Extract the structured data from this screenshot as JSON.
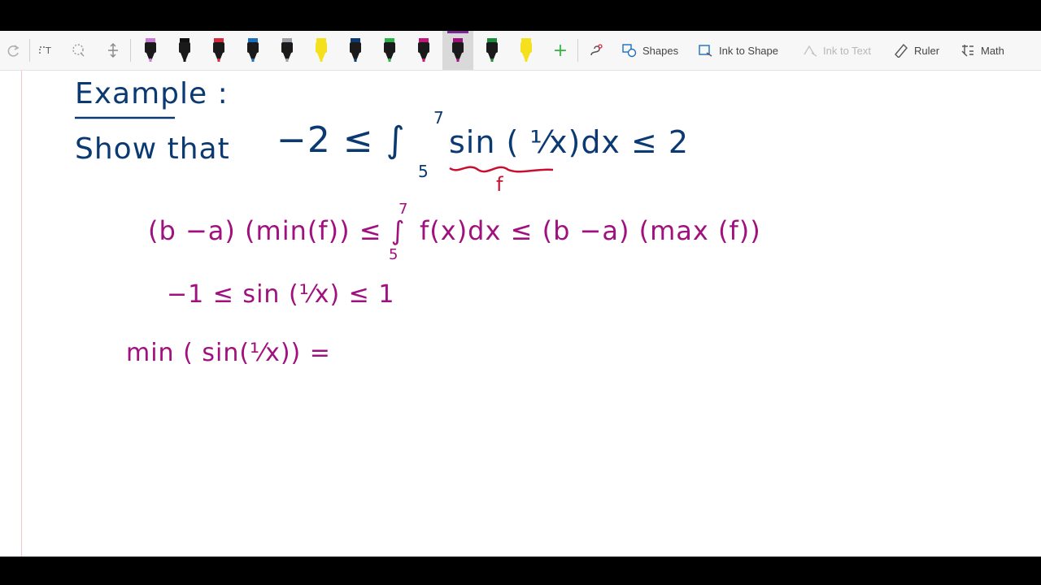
{
  "toolbar": {
    "tools": [
      {
        "name": "redo-icon",
        "label": ""
      },
      {
        "name": "lasso-select-icon",
        "label": ""
      },
      {
        "name": "lasso-dotted-icon",
        "label": ""
      },
      {
        "name": "add-space-icon",
        "label": ""
      }
    ],
    "pens": [
      {
        "name": "pen-pink",
        "color": "#c77dd6"
      },
      {
        "name": "pen-black",
        "color": "#111111"
      },
      {
        "name": "pen-red",
        "color": "#d6293e"
      },
      {
        "name": "pen-blue",
        "color": "#1b6fc0"
      },
      {
        "name": "pen-gray",
        "color": "#9aa0a6"
      },
      {
        "name": "highlighter-yellow",
        "color": "#f4e01c"
      },
      {
        "name": "pen-navy",
        "color": "#0b3a73"
      },
      {
        "name": "pen-green",
        "color": "#2db24a"
      },
      {
        "name": "pen-magenta",
        "color": "#c2187a"
      },
      {
        "name": "pen-purple-selected",
        "color": "#a0107e"
      },
      {
        "name": "pen-darkgreen",
        "color": "#1e8b3a"
      },
      {
        "name": "highlighter-yellow-2",
        "color": "#f4e01c"
      }
    ],
    "add_pen": "+",
    "shapes_label": "Shapes",
    "ink_to_shape_label": "Ink to Shape",
    "ink_to_text_label": "Ink to Text",
    "ruler_label": "Ruler",
    "math_label": "Math"
  },
  "canvas": {
    "heading": "Example :",
    "show_that": "Show that",
    "statement": "−2  ≤  ∫",
    "upper_limit": "7",
    "lower_limit": "5",
    "integrand": "sin ( ¹⁄x)dx ≤  2",
    "f_label": "f",
    "line1_left": "(b −a) (min(f))  ≤  ∫",
    "line1_upper": "7",
    "line1_lower": "5",
    "line1_right": "f(x)dx  ≤  (b −a) (max (f))",
    "line2": "−1 ≤ sin (¹⁄x) ≤ 1",
    "line3": "min ( sin(¹⁄x))  ="
  },
  "colors": {
    "ink_blue": "#0b3a73",
    "ink_purple": "#a0107e",
    "ink_red": "#c8102e",
    "accent_purple": "#7a2b8f"
  }
}
